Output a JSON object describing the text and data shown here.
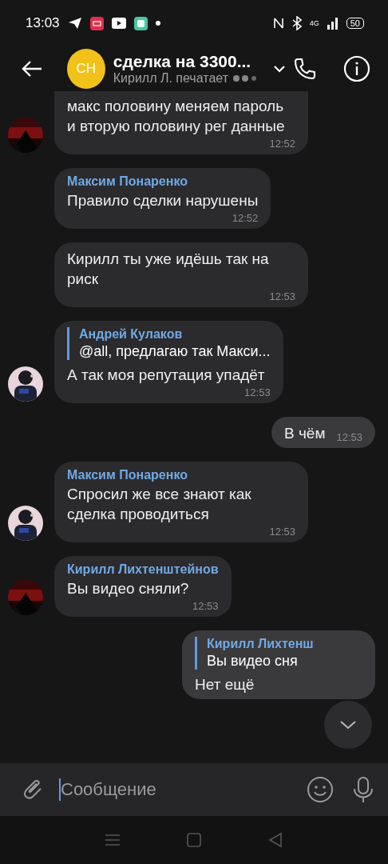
{
  "status_bar": {
    "time": "13:03",
    "network": "4G",
    "battery": "50"
  },
  "header": {
    "avatar_initials": "СН",
    "title": "сделка на 3300...",
    "subtitle": "Кирилл Л. печатает"
  },
  "messages": [
    {
      "kind": "incoming",
      "text": "макс половину меняем пароль и вторую половину рег данные",
      "time": "12:52",
      "avatar": true
    },
    {
      "kind": "incoming",
      "sender": "Максим Понаренко",
      "text": "Правило сделки нарушены",
      "time": "12:52"
    },
    {
      "kind": "incoming",
      "text": "Кирилл ты уже идёшь так на риск",
      "time": "12:53"
    },
    {
      "kind": "incoming",
      "reply": {
        "author": "Андрей Кулаков",
        "text": "@all,  предлагаю так Макси..."
      },
      "text": "А так моя репутация упадёт",
      "time": "12:53",
      "avatar": true
    },
    {
      "kind": "outgoing",
      "text": "В чём",
      "time": "12:53"
    },
    {
      "kind": "incoming",
      "sender": "Максим Понаренко",
      "text": "Спросил же все знают как сделка проводиться",
      "time": "12:53",
      "avatar": true
    },
    {
      "kind": "incoming",
      "sender": "Кирилл Лихтенштейнов",
      "text": "Вы видео сняли?",
      "time": "12:53",
      "avatar": true
    },
    {
      "kind": "outgoing",
      "reply": {
        "author": "Кирилл Лихтенш",
        "text": "Вы видео сня"
      },
      "text": "Нет ещё"
    }
  ],
  "composer": {
    "placeholder": "Сообщение"
  }
}
